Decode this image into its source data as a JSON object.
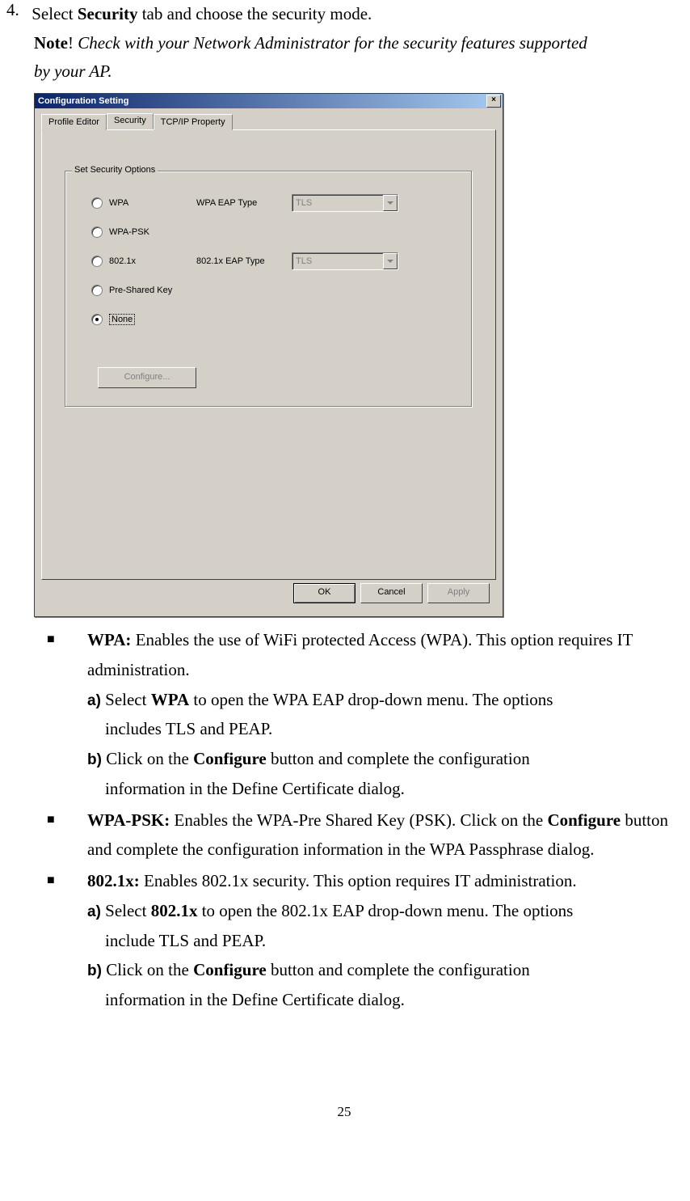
{
  "step": {
    "number": "4.",
    "text_a": "Select ",
    "text_bold": "Security",
    "text_b": " tab and choose the security mode."
  },
  "note": {
    "label": "Note",
    "excl": "! ",
    "text_a": "Check with your Network Administrator for the security features supported",
    "text_b": "by your AP."
  },
  "dialog": {
    "title": "Configuration Setting",
    "close": "×",
    "tabs": {
      "profile": "Profile Editor",
      "security": "Security",
      "tcpip": "TCP/IP Property"
    },
    "group_title": "Set Security Options",
    "options": {
      "wpa": "WPA",
      "wpapsk": "WPA-PSK",
      "dot1x": "802.1x",
      "psk": "Pre-Shared Key",
      "none": "None"
    },
    "eap": {
      "wpa_label": "WPA EAP Type",
      "dot1x_label": "802.1x EAP Type",
      "value": "TLS"
    },
    "configure": "Configure...",
    "buttons": {
      "ok": "OK",
      "cancel": "Cancel",
      "apply": "Apply"
    }
  },
  "bullets": {
    "wpa": {
      "head": "WPA:",
      "text": " Enables the use of WiFi protected Access (WPA). This option requires IT administration.",
      "a_pre": " Select ",
      "a_bold": "WPA",
      "a_post": " to open the WPA EAP drop-down menu. The options",
      "a_line2": "includes TLS and PEAP.",
      "b_pre": " Click on the ",
      "b_bold": "Configure",
      "b_post": " button and complete the configuration",
      "b_line2": "information in the Define Certificate dialog."
    },
    "wpapsk": {
      "head": "WPA-PSK:",
      "text_a": " Enables the WPA-Pre Shared Key (PSK). Click on the ",
      "text_bold": "Configure",
      "text_b": " button and complete the configuration information in the WPA Passphrase dialog."
    },
    "dot1x": {
      "head": "802.1x:",
      "text": " Enables 802.1x security. This option requires IT administration.",
      "a_pre": " Select ",
      "a_bold": "802.1x",
      "a_post": " to open the 802.1x EAP drop-down menu. The options",
      "a_line2": "include TLS and PEAP.",
      "b_pre": " Click on the ",
      "b_bold": "Configure",
      "b_post": " button and complete the configuration",
      "b_line2": "information in the Define Certificate dialog."
    },
    "labels": {
      "a": "a)",
      "b": "b)"
    }
  },
  "page_number": "25"
}
